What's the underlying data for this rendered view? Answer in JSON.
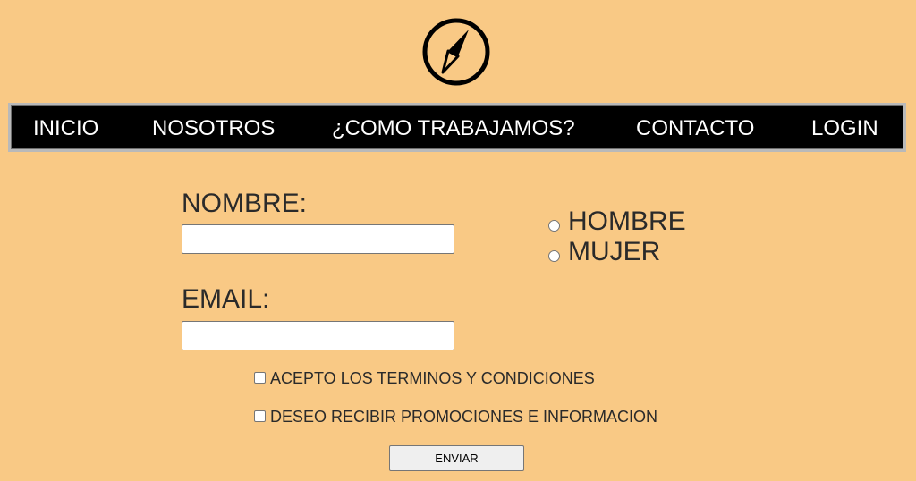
{
  "logo": {
    "icon": "compass-icon"
  },
  "nav": {
    "items": [
      {
        "label": "INICIO"
      },
      {
        "label": "NOSOTROS"
      },
      {
        "label": "¿COMO TRABAJAMOS?"
      },
      {
        "label": "CONTACTO"
      },
      {
        "label": "LOGIN"
      }
    ]
  },
  "form": {
    "name_label": "NOMBRE:",
    "name_value": "",
    "email_label": "EMAIL:",
    "email_value": "",
    "gender_options": [
      {
        "label": "HOMBRE",
        "checked": false
      },
      {
        "label": "MUJER",
        "checked": false
      }
    ],
    "checkboxes": [
      {
        "label": "ACEPTO LOS TERMINOS Y CONDICIONES",
        "checked": false
      },
      {
        "label": "DESEO RECIBIR PROMOCIONES E INFORMACION",
        "checked": false
      }
    ],
    "submit_label": "ENVIAR"
  },
  "colors": {
    "background": "#f9c985",
    "nav_background": "#000000",
    "nav_text": "#ffffff",
    "text": "#2a2a2a"
  }
}
